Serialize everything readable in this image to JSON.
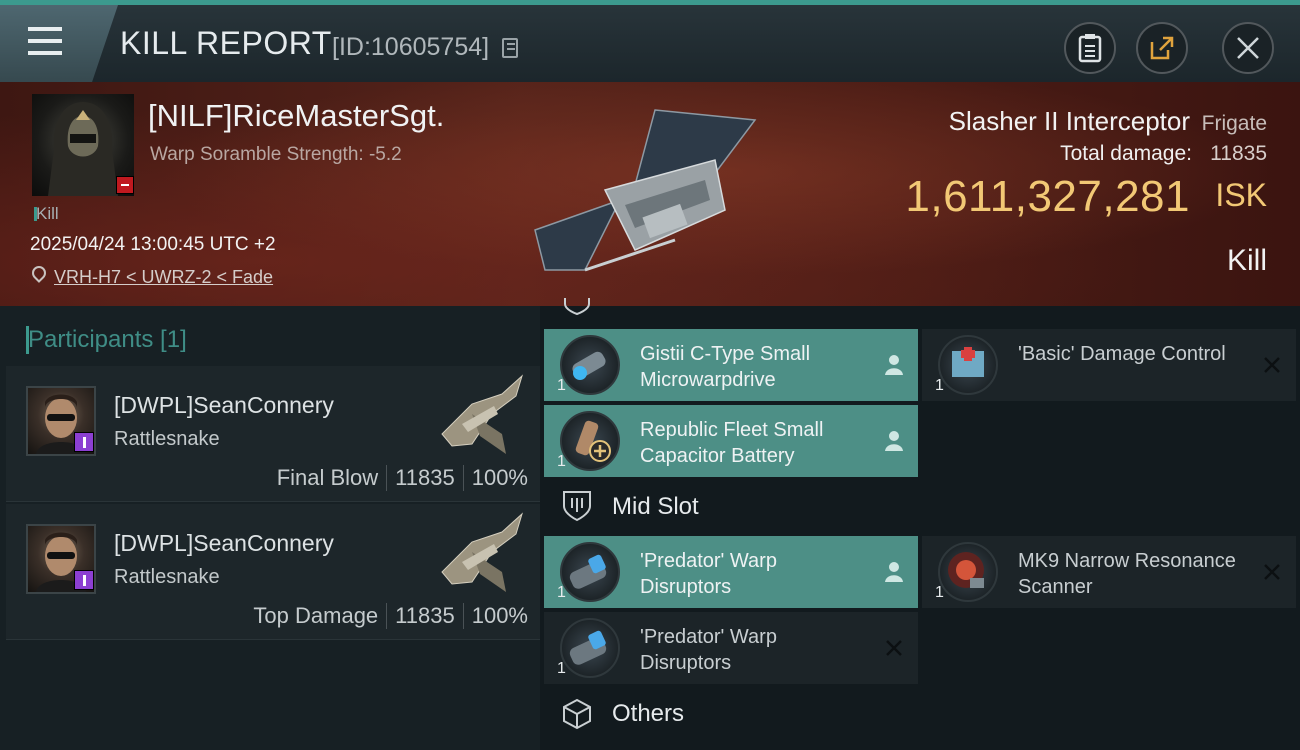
{
  "header": {
    "title": "KILL REPORT",
    "kill_id": "[ID:10605754]"
  },
  "victim": {
    "name": "[NILF]RiceMasterSgt.",
    "scramble": "Warp Soramble Strength: -5.2",
    "tag": "Kill",
    "datetime": "2025/04/24 13:00:45 UTC +2",
    "location": "VRH-H7 < UWRZ-2 < Fade",
    "ship_name": "Slasher II Interceptor",
    "ship_class": "Frigate",
    "total_damage_label": "Total damage:",
    "total_damage": "11835",
    "isk_value": "1,611,327,281",
    "isk_unit": "ISK",
    "result": "Kill"
  },
  "participants": {
    "header": "Participants [1]",
    "items": [
      {
        "name": "[DWPL]SeanConnery",
        "ship": "Rattlesnake",
        "role": "Final Blow",
        "damage": "11835",
        "percent": "100%"
      },
      {
        "name": "[DWPL]SeanConnery",
        "ship": "Rattlesnake",
        "role": "Top Damage",
        "damage": "11835",
        "percent": "100%"
      }
    ]
  },
  "modules": {
    "low": [
      {
        "name": "Gistii C-Type Small Microwarpdrive",
        "qty": "1",
        "status": "fitted"
      },
      {
        "name": "'Basic' Damage Control",
        "qty": "1",
        "status": "destroyed"
      },
      {
        "name": "Republic Fleet Small Capacitor Battery",
        "qty": "1",
        "status": "fitted"
      }
    ],
    "mid_header": "Mid Slot",
    "mid": [
      {
        "name": "'Predator' Warp Disruptors",
        "qty": "1",
        "status": "fitted"
      },
      {
        "name": "MK9 Narrow Resonance Scanner",
        "qty": "1",
        "status": "destroyed"
      },
      {
        "name": "'Predator' Warp Disruptors",
        "qty": "1",
        "status": "destroyed"
      }
    ],
    "others_header": "Others"
  },
  "colors": {
    "accent": "#3c9a8e",
    "isk": "#f2c875",
    "highlight": "#4d8f86"
  }
}
